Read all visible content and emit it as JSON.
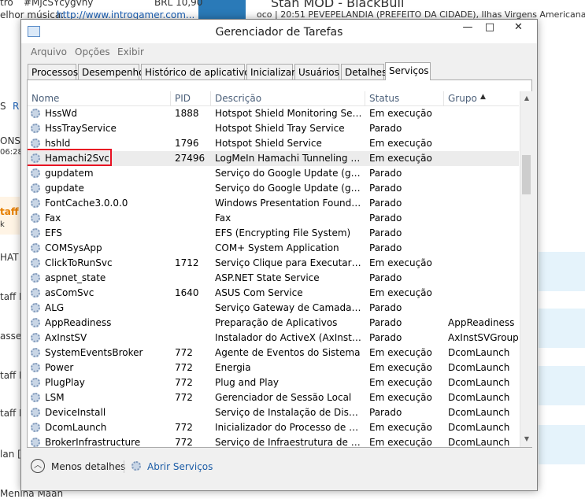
{
  "background": {
    "texts": [
      {
        "id": "bg1",
        "text": "tro"
      },
      {
        "id": "bg2",
        "text": "#MjcSYcygvny"
      },
      {
        "id": "bg3",
        "text": "BRL 10,90"
      },
      {
        "id": "bg4",
        "text": "elhor música:"
      },
      {
        "id": "bg5",
        "text": "http://www.introgamer.com..."
      },
      {
        "id": "bg6",
        "text": "Stan MOD - BlackBull"
      },
      {
        "id": "bg7",
        "text": "oco | 20:51 PEVEPELANDIA (PREFEITO DA CIDADE), Ilhas Virgens Americanas"
      },
      {
        "id": "bg8",
        "text": "S"
      },
      {
        "id": "bg9",
        "text": "R"
      },
      {
        "id": "bg10",
        "text": "ONS"
      },
      {
        "id": "bg11",
        "text": "06:28"
      },
      {
        "id": "bg12",
        "text": "taff"
      },
      {
        "id": "bg13",
        "text": "k"
      },
      {
        "id": "bg14",
        "text": "HAT"
      },
      {
        "id": "bg15",
        "text": "taff I"
      },
      {
        "id": "bg16",
        "text": "asse"
      },
      {
        "id": "bg17",
        "text": "taff D"
      },
      {
        "id": "bg18",
        "text": "taff D"
      },
      {
        "id": "bg19",
        "text": "lan ["
      },
      {
        "id": "bg20",
        "text": "Menina Maan"
      }
    ]
  },
  "window": {
    "title": "Gerenciador de Tarefas",
    "controls": {
      "minimize": "—",
      "maximize": "□",
      "close": "✕"
    },
    "icon": "task-manager-icon"
  },
  "menu": [
    "Arquivo",
    "Opções",
    "Exibir"
  ],
  "tabs": [
    "Processos",
    "Desempenho",
    "Histórico de aplicativos",
    "Inicializar",
    "Usuários",
    "Detalhes",
    "Serviços"
  ],
  "active_tab": "Serviços",
  "columns": [
    "Nome",
    "PID",
    "Descrição",
    "Status",
    "Grupo"
  ],
  "sort_indicator": "▲",
  "services": [
    {
      "name": "HssWd",
      "pid": "1888",
      "desc": "Hotspot Shield Monitoring Service",
      "status": "Em execução",
      "group": ""
    },
    {
      "name": "HssTrayService",
      "pid": "",
      "desc": "Hotspot Shield Tray Service",
      "status": "Parado",
      "group": ""
    },
    {
      "name": "hshld",
      "pid": "1796",
      "desc": "Hotspot Shield Service",
      "status": "Em execução",
      "group": ""
    },
    {
      "name": "Hamachi2Svc",
      "pid": "27496",
      "desc": "LogMeIn Hamachi Tunneling En...",
      "status": "Em execução",
      "group": ""
    },
    {
      "name": "gupdatem",
      "pid": "",
      "desc": "Serviço do Google Update (gupd...",
      "status": "Parado",
      "group": ""
    },
    {
      "name": "gupdate",
      "pid": "",
      "desc": "Serviço do Google Update (gupd...",
      "status": "Parado",
      "group": ""
    },
    {
      "name": "FontCache3.0.0.0",
      "pid": "",
      "desc": "Windows Presentation Foundati...",
      "status": "Parado",
      "group": ""
    },
    {
      "name": "Fax",
      "pid": "",
      "desc": "Fax",
      "status": "Parado",
      "group": ""
    },
    {
      "name": "EFS",
      "pid": "",
      "desc": "EFS (Encrypting File System)",
      "status": "Parado",
      "group": ""
    },
    {
      "name": "COMSysApp",
      "pid": "",
      "desc": "COM+ System Application",
      "status": "Parado",
      "group": ""
    },
    {
      "name": "ClickToRunSvc",
      "pid": "1712",
      "desc": "Serviço Clique para Executar do ...",
      "status": "Em execução",
      "group": ""
    },
    {
      "name": "aspnet_state",
      "pid": "",
      "desc": "ASP.NET State Service",
      "status": "Parado",
      "group": ""
    },
    {
      "name": "asComSvc",
      "pid": "1640",
      "desc": "ASUS Com Service",
      "status": "Em execução",
      "group": ""
    },
    {
      "name": "ALG",
      "pid": "",
      "desc": "Serviço Gateway de Camada de ...",
      "status": "Parado",
      "group": ""
    },
    {
      "name": "AppReadiness",
      "pid": "",
      "desc": "Preparação de Aplicativos",
      "status": "Parado",
      "group": "AppReadiness"
    },
    {
      "name": "AxInstSV",
      "pid": "",
      "desc": "Instalador do ActiveX (AxInstSV)",
      "status": "Parado",
      "group": "AxInstSVGroup"
    },
    {
      "name": "SystemEventsBroker",
      "pid": "772",
      "desc": "Agente de Eventos do Sistema",
      "status": "Em execução",
      "group": "DcomLaunch"
    },
    {
      "name": "Power",
      "pid": "772",
      "desc": "Energia",
      "status": "Em execução",
      "group": "DcomLaunch"
    },
    {
      "name": "PlugPlay",
      "pid": "772",
      "desc": "Plug and Play",
      "status": "Em execução",
      "group": "DcomLaunch"
    },
    {
      "name": "LSM",
      "pid": "772",
      "desc": "Gerenciador de Sessão Local",
      "status": "Em execução",
      "group": "DcomLaunch"
    },
    {
      "name": "DeviceInstall",
      "pid": "",
      "desc": "Serviço de Instalação de Disposit...",
      "status": "Parado",
      "group": "DcomLaunch"
    },
    {
      "name": "DcomLaunch",
      "pid": "772",
      "desc": "Inicializador do Processo de Servi...",
      "status": "Em execução",
      "group": "DcomLaunch"
    },
    {
      "name": "BrokerInfrastructure",
      "pid": "772",
      "desc": "Serviço de Infraestrutura de Taref...",
      "status": "Em execução",
      "group": "DcomLaunch"
    }
  ],
  "selected_service": "Hamachi2Svc",
  "footer": {
    "less_details": "Menos detalhes",
    "open_services": "Abrir Serviços"
  },
  "colors": {
    "highlight_box": "#e81123",
    "link": "#1c5ca6",
    "selected_row": "#ececec"
  }
}
